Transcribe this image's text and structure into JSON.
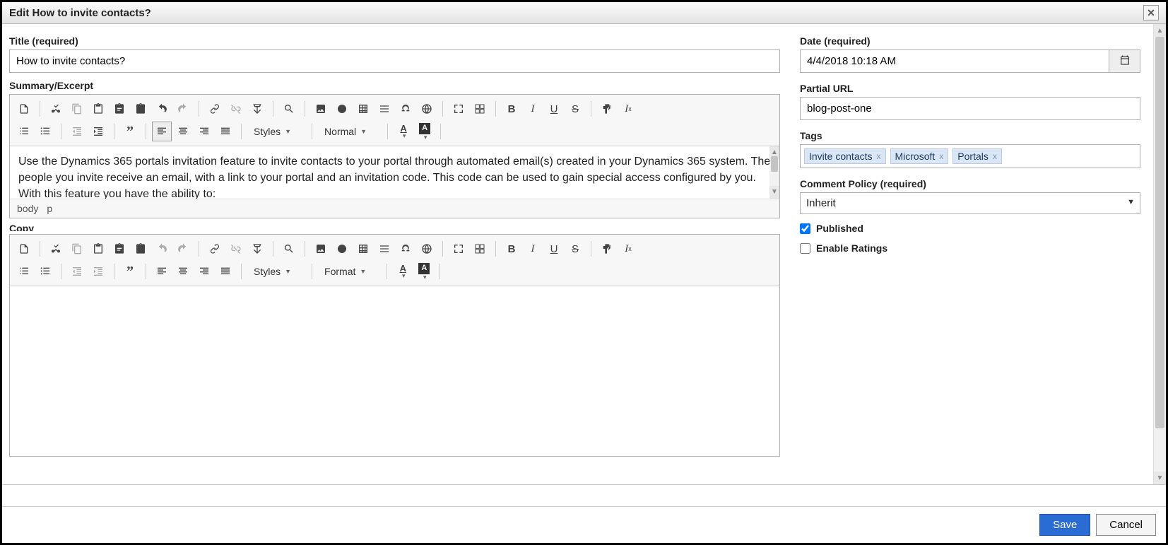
{
  "dialog": {
    "title": "Edit How to invite contacts?"
  },
  "left": {
    "title_label": "Title (required)",
    "title_value": "How to invite contacts?",
    "summary_label": "Summary/Excerpt",
    "summary_body": "Use the Dynamics 365 portals invitation feature to invite contacts to your portal through automated email(s) created in your Dynamics 365 system. The people you invite receive an email, with a link to your portal and an invitation code. This code can be used to gain special access configured by you. With this feature you have the ability to:",
    "summary_path": [
      "body",
      "p"
    ],
    "copy_label": "Copy",
    "toolbar": {
      "styles": "Styles",
      "format_normal": "Normal",
      "format": "Format"
    }
  },
  "right": {
    "date_label": "Date (required)",
    "date_value": "4/4/2018 10:18 AM",
    "partial_url_label": "Partial URL",
    "partial_url_value": "blog-post-one",
    "tags_label": "Tags",
    "tags": [
      "Invite contacts",
      "Microsoft",
      "Portals"
    ],
    "comment_policy_label": "Comment Policy (required)",
    "comment_policy_value": "Inherit",
    "published_label": "Published",
    "ratings_label": "Enable Ratings",
    "published_checked": true,
    "ratings_checked": false
  },
  "footer": {
    "save": "Save",
    "cancel": "Cancel"
  }
}
